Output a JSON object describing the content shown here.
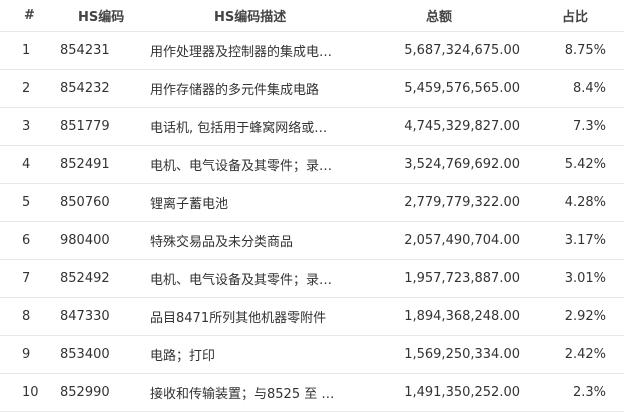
{
  "headers": {
    "idx": "#",
    "code": "HS编码",
    "desc": "HS编码描述",
    "total": "总额",
    "pct": "占比"
  },
  "rows": [
    {
      "idx": "1",
      "code": "854231",
      "desc": "用作处理器及控制器的集成电…",
      "total": "5,687,324,675.00",
      "pct": "8.75%"
    },
    {
      "idx": "2",
      "code": "854232",
      "desc": "用作存储器的多元件集成电路",
      "total": "5,459,576,565.00",
      "pct": "8.4%"
    },
    {
      "idx": "3",
      "code": "851779",
      "desc": "电话机, 包括用于蜂窝网络或…",
      "total": "4,745,329,827.00",
      "pct": "7.3%"
    },
    {
      "idx": "4",
      "code": "852491",
      "desc": "电机、电气设备及其零件；录…",
      "total": "3,524,769,692.00",
      "pct": "5.42%"
    },
    {
      "idx": "5",
      "code": "850760",
      "desc": "锂离子蓄电池",
      "total": "2,779,779,322.00",
      "pct": "4.28%"
    },
    {
      "idx": "6",
      "code": "980400",
      "desc": "特殊交易品及未分类商品",
      "total": "2,057,490,704.00",
      "pct": "3.17%"
    },
    {
      "idx": "7",
      "code": "852492",
      "desc": "电机、电气设备及其零件；录…",
      "total": "1,957,723,887.00",
      "pct": "3.01%"
    },
    {
      "idx": "8",
      "code": "847330",
      "desc": "品目8471所列其他机器零附件",
      "total": "1,894,368,248.00",
      "pct": "2.92%"
    },
    {
      "idx": "9",
      "code": "853400",
      "desc": "电路；打印",
      "total": "1,569,250,334.00",
      "pct": "2.42%"
    },
    {
      "idx": "10",
      "code": "852990",
      "desc": "接收和传输装置；与8525 至 …",
      "total": "1,491,350,252.00",
      "pct": "2.3%"
    }
  ]
}
